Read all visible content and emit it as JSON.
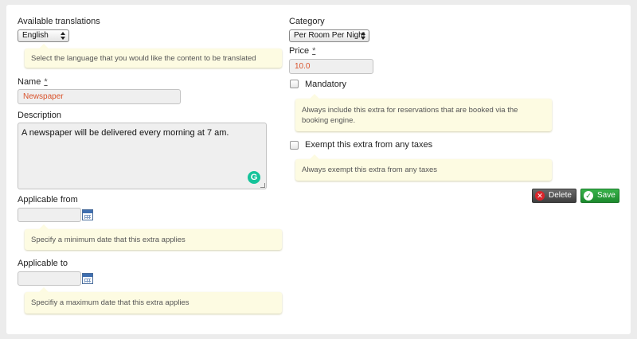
{
  "form": {
    "translations": {
      "label": "Available translations",
      "selected": "English",
      "hint": "Select the language that you would like the content to be translated"
    },
    "name": {
      "label": "Name",
      "required_mark": "*",
      "value": "Newspaper"
    },
    "description": {
      "label": "Description",
      "value": "A newspaper will be delivered every morning at 7 am."
    },
    "applicable_from": {
      "label": "Applicable from",
      "value": "",
      "hint": "Specify a minimum date that this extra applies"
    },
    "applicable_to": {
      "label": "Applicable to",
      "value": "",
      "hint": "Specifiy a maximum date that this extra applies"
    },
    "category": {
      "label": "Category",
      "selected": "Per Room Per Night"
    },
    "price": {
      "label": "Price",
      "required_mark": "*",
      "value": "10.0"
    },
    "mandatory": {
      "label": "Mandatory",
      "checked": false,
      "hint": "Always include this extra for reservations that are booked via the booking engine."
    },
    "exempt_taxes": {
      "label": "Exempt this extra from any taxes",
      "checked": false,
      "hint": "Always exempt this extra from any taxes"
    }
  },
  "actions": {
    "delete_label": "Delete",
    "save_label": "Save"
  },
  "icons": {
    "calendar": "calendar-icon",
    "grammarly": "grammarly-icon",
    "delete": "delete-x-icon",
    "save": "checkmark-icon"
  },
  "colors": {
    "input_value": "#d9532c",
    "hint_background": "#fdfbe2",
    "save_button": "#1c8a2d",
    "delete_button": "#3e3e3e",
    "grammarly": "#15c39a"
  }
}
